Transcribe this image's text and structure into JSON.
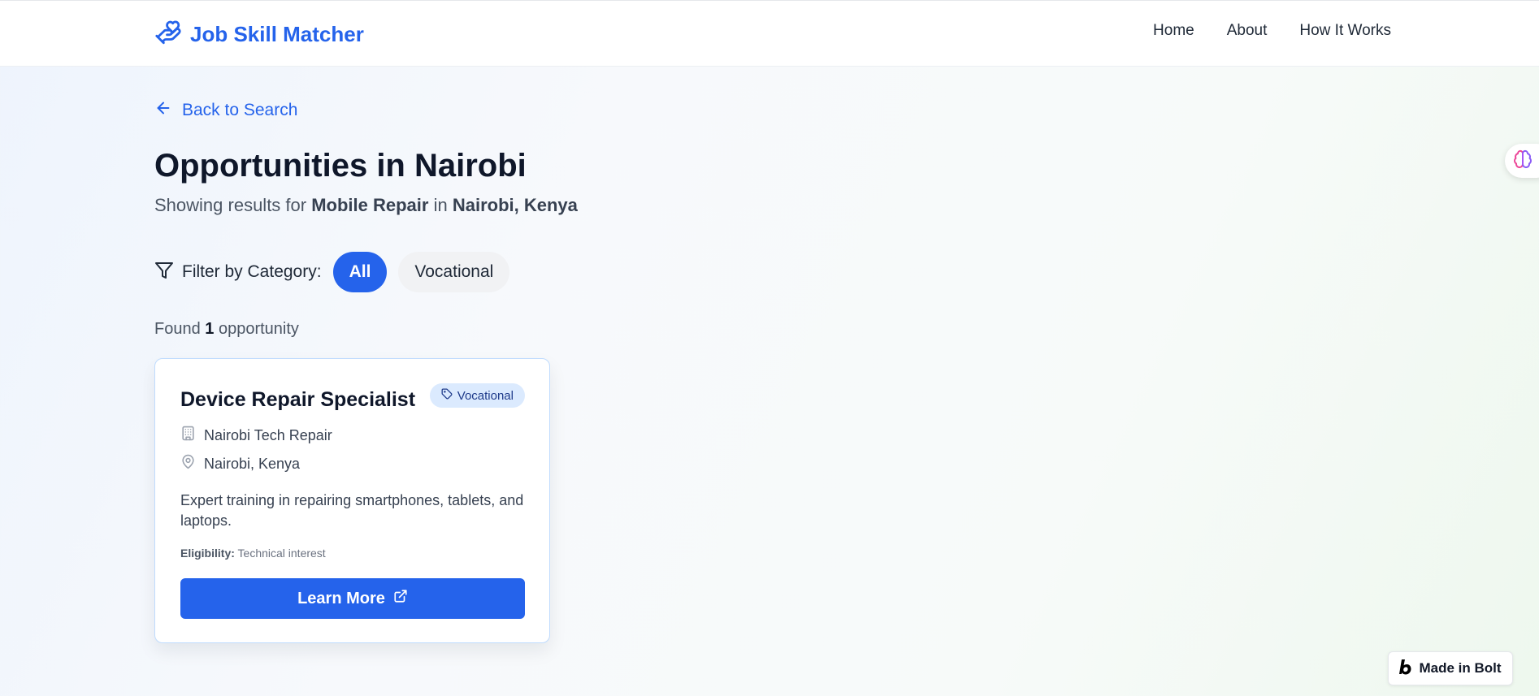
{
  "header": {
    "brand": "Job Skill Matcher",
    "nav": [
      "Home",
      "About",
      "How It Works"
    ]
  },
  "back_link": "Back to Search",
  "page_title": "Opportunities in Nairobi",
  "subtitle": {
    "prefix": "Showing results for",
    "skill": "Mobile Repair",
    "mid": "in",
    "location": "Nairobi, Kenya"
  },
  "filter": {
    "label": "Filter by Category:",
    "options": [
      "All",
      "Vocational"
    ],
    "selected": "All"
  },
  "found": {
    "prefix": "Found",
    "count": "1",
    "suffix": "opportunity"
  },
  "opportunity": {
    "title": "Device Repair Specialist",
    "category": "Vocational",
    "company": "Nairobi Tech Repair",
    "location": "Nairobi, Kenya",
    "description": "Expert training in repairing smartphones, tablets, and laptops.",
    "eligibility_label": "Eligibility:",
    "eligibility": "Technical interest",
    "button": "Learn More"
  },
  "bolt_badge": "Made in Bolt",
  "colors": {
    "accent": "#2563eb",
    "badge_bg": "#dbeafe",
    "badge_text": "#1e3a8a"
  }
}
